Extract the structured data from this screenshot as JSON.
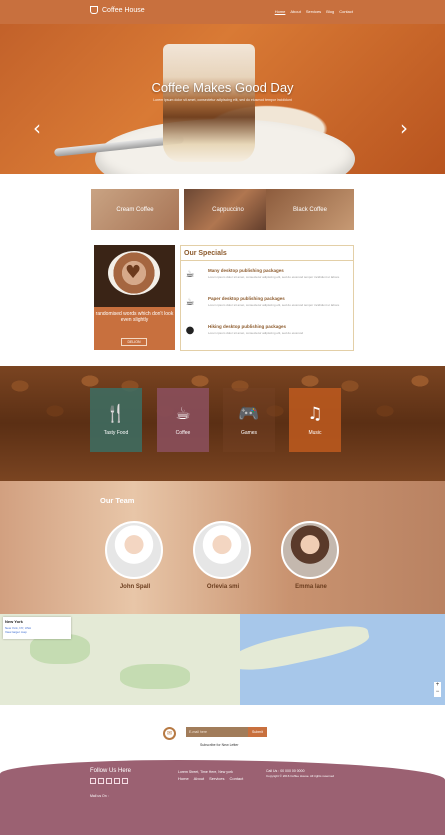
{
  "header": {
    "brand": "Coffee House",
    "nav": [
      "Home",
      "About",
      "Services",
      "Blog",
      "Contact"
    ]
  },
  "hero": {
    "title": "Coffee Makes Good Day",
    "subtitle": "Lorem ipsum dolor sit amet, consectetur adipiscing elit, sed do eiusmod tempor incididunt"
  },
  "tiles": [
    "Cream Coffee",
    "Cappuccino",
    "Black Coffee"
  ],
  "promo": {
    "text": "randomised words which don't look even slightly",
    "button": "DELION"
  },
  "specials": {
    "title": "Our Specials",
    "items": [
      {
        "icon": "coffee-machine-icon",
        "title": "Many desktop publishing packages",
        "body": "Lorem ipsum dolor sit amet, consectetur adipiscing elit, sed do eiusmod tempor incididunt ut labore"
      },
      {
        "icon": "cup-icon",
        "title": "Paper desktop publishing packages",
        "body": "Lorem ipsum dolor sit amet, consectetur adipiscing elit, sed do eiusmod tempor incididunt ut labore"
      },
      {
        "icon": "location-pin-icon",
        "title": "Hiking desktop publishing packages",
        "body": "Lorem ipsum dolor sit amet, consectetur adipiscing elit, sed do eiusmod"
      }
    ]
  },
  "services": [
    "Tasty Food",
    "Coffee",
    "Games",
    "Music"
  ],
  "team": {
    "title": "Our Team",
    "members": [
      "John Spall",
      "Orlevia smi",
      "Emma lane"
    ]
  },
  "map": {
    "place": "New York",
    "address": "New York, NY, USA",
    "link": "View larger map"
  },
  "subscribe": {
    "placeholder": "E-mail here",
    "button": "Submit",
    "text": "Subscribe for New Letter"
  },
  "footer": {
    "follow": "Follow Us Here",
    "mail_label": "Mail us On :",
    "address": "Lorem Street, Time Here, New york",
    "links": [
      "Home",
      "About",
      "Services",
      "Contact"
    ],
    "call": "Call Us : 00 000 00 0000",
    "copyright": "Copyright © 2016 Coffee House. All rights reserved"
  },
  "colors": {
    "header": "#c8703e",
    "footer": "#9b6172",
    "accent": "#b77a44"
  }
}
